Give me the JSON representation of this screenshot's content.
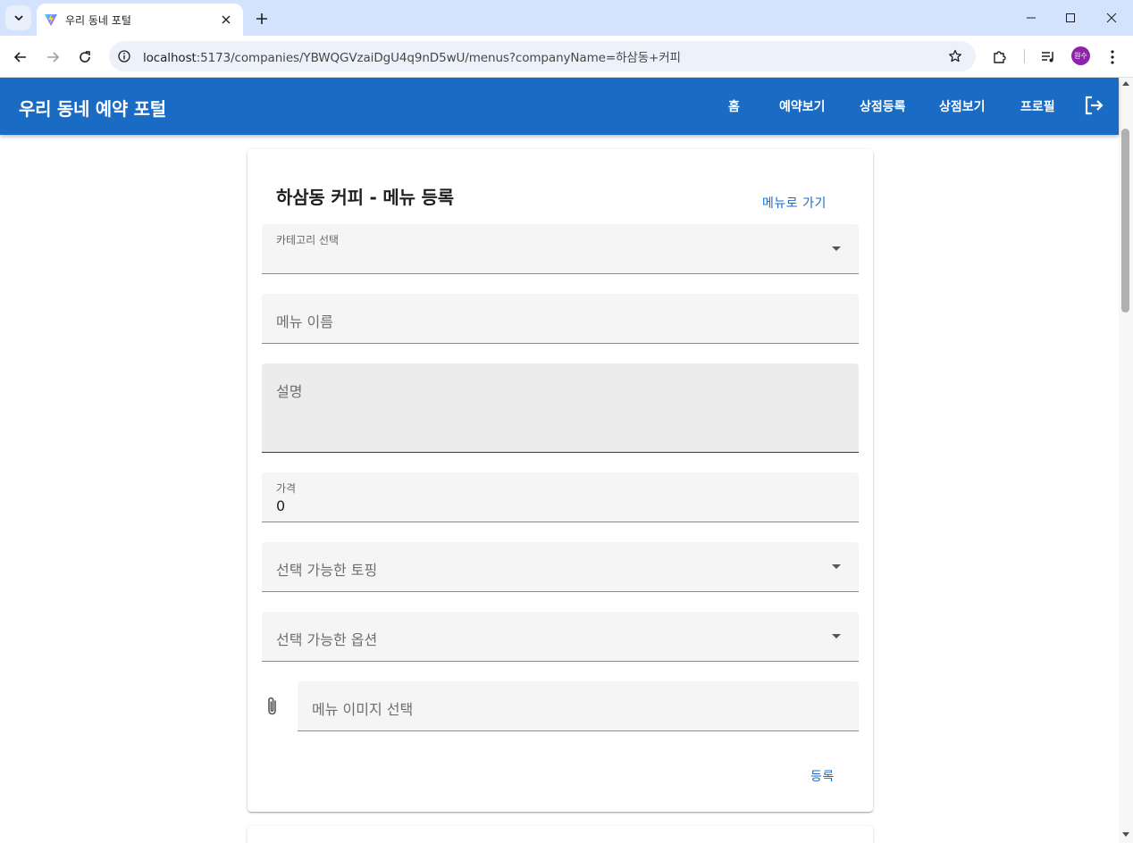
{
  "browser": {
    "tab_title": "우리 동네 포털",
    "url_host": "localhost",
    "url_path": ":5173/companies/YBWQGVzaiDgU4q9nD5wU/menus?companyName=하삼동+커피",
    "profile_initials": "원수"
  },
  "appbar": {
    "title": "우리 동네 예약 포털",
    "nav": [
      "홈",
      "예약보기",
      "상점등록",
      "상점보기",
      "프로필"
    ]
  },
  "form": {
    "title": "하삼동 커피 - 메뉴 등록",
    "back_link": "메뉴로 가기",
    "category_label": "카테고리 선택",
    "menu_name_placeholder": "메뉴 이름",
    "description_placeholder": "설명",
    "price_label": "가격",
    "price_value": "0",
    "toppings_placeholder": "선택 가능한 토핑",
    "options_placeholder": "선택 가능한 옵션",
    "image_placeholder": "메뉴 이미지 선택",
    "submit_label": "등록"
  },
  "colors": {
    "primary": "#1a6bc3",
    "tabstrip": "#d3e3fd",
    "avatar": "#8e24aa"
  }
}
